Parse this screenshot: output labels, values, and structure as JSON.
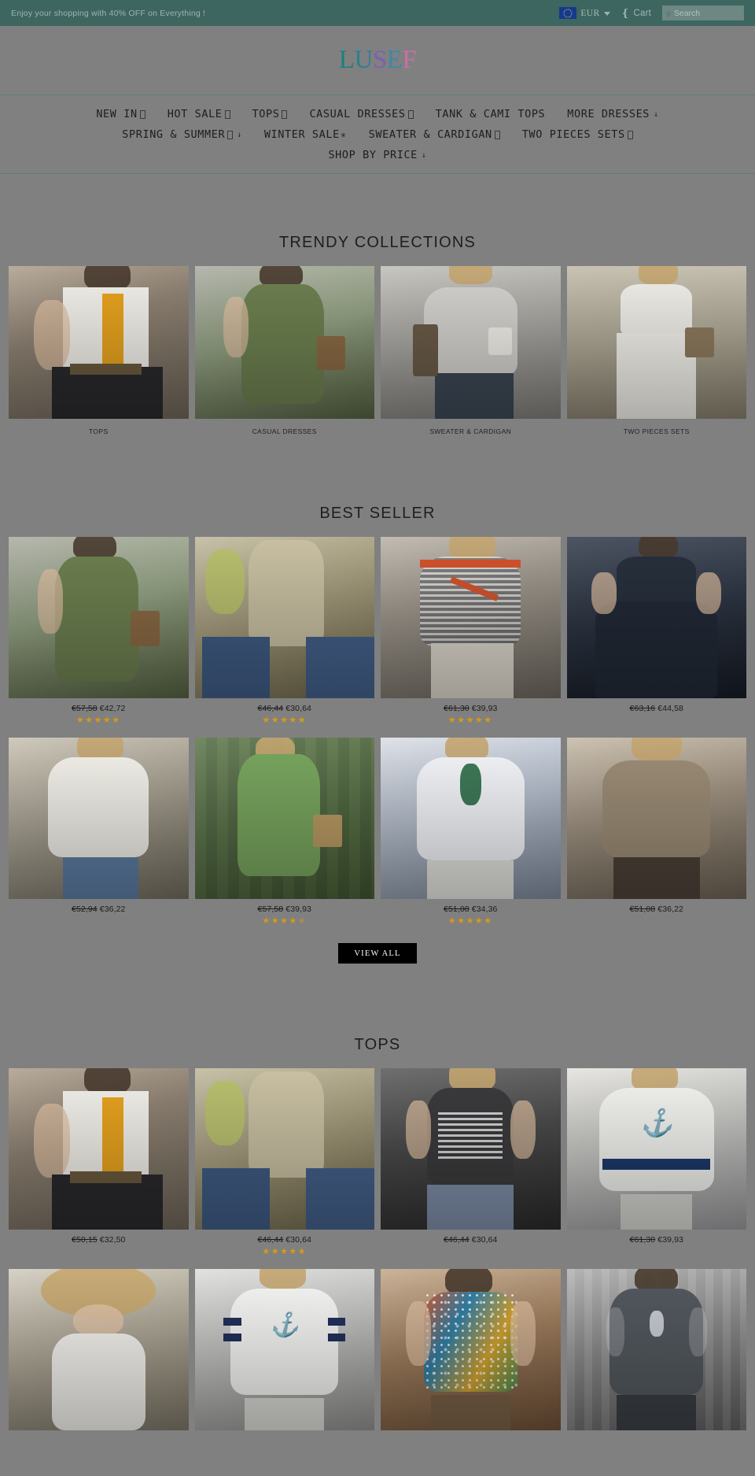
{
  "announcement": {
    "text": "Enjoy your shopping with 40% OFF on Everything !",
    "currency": {
      "code": "EUR",
      "flag_icon": "eu-flag-icon"
    },
    "cart": {
      "label": "Cart",
      "icon": "cart-icon"
    },
    "search": {
      "placeholder": "Search",
      "value": "",
      "icon": "search-icon"
    },
    "bar_color": "#3d6660"
  },
  "brand": {
    "name": "LUSEF",
    "letters": [
      "L",
      "U",
      "S",
      "E",
      "F"
    ]
  },
  "nav": {
    "rows": [
      [
        {
          "label": "NEW IN",
          "badge": true,
          "arrow": false
        },
        {
          "label": "HOT SALE",
          "badge": true,
          "arrow": false
        },
        {
          "label": "TOPS",
          "badge": true,
          "arrow": false
        },
        {
          "label": "CASUAL DRESSES",
          "badge": true,
          "arrow": false
        },
        {
          "label": "TANK & CAMI TOPS",
          "badge": false,
          "arrow": false
        },
        {
          "label": "MORE DRESSES",
          "badge": false,
          "arrow": true
        }
      ],
      [
        {
          "label": "SPRING & SUMMER",
          "badge": true,
          "arrow": true
        },
        {
          "label": "WINTER SALE",
          "badge": false,
          "arrow": false,
          "star": true
        },
        {
          "label": "SWEATER & CARDIGAN",
          "badge": true,
          "arrow": false
        },
        {
          "label": "TWO PIECES SETS",
          "badge": true,
          "arrow": false
        }
      ],
      [
        {
          "label": "SHOP BY PRICE",
          "badge": false,
          "arrow": true
        }
      ]
    ]
  },
  "sections": {
    "trendy": {
      "title": "TRENDY COLLECTIONS",
      "tiles": [
        {
          "caption": "TOPS",
          "art": "p-tops"
        },
        {
          "caption": "CASUAL DRESSES",
          "art": "p-greendr"
        },
        {
          "caption": "SWEATER & CARDIGAN",
          "art": "p-sweater"
        },
        {
          "caption": "TWO PIECES SETS",
          "art": "p-twopiece"
        }
      ]
    },
    "best_seller": {
      "title": "BEST SELLER",
      "view_all_label": "VIEW ALL",
      "products": [
        {
          "old_price": "€57,58",
          "new_price": "€42,72",
          "rating": 5,
          "art": "p-greendr"
        },
        {
          "old_price": "€46,44",
          "new_price": "€30,64",
          "rating": 5,
          "art": "p-lace"
        },
        {
          "old_price": "€61,30",
          "new_price": "€39,93",
          "rating": 5,
          "art": "p-stripe"
        },
        {
          "old_price": "€63,16",
          "new_price": "€44,58",
          "rating": 0,
          "art": "p-navy"
        },
        {
          "old_price": "€52,94",
          "new_price": "€36,22",
          "rating": 0,
          "art": "p-floral"
        },
        {
          "old_price": "€57,58",
          "new_price": "€39,93",
          "rating": 4.5,
          "art": "p-greendoor"
        },
        {
          "old_price": "€51,08",
          "new_price": "€34,36",
          "rating": 5,
          "art": "p-bluedot"
        },
        {
          "old_price": "€51,08",
          "new_price": "€36,22",
          "rating": 0,
          "art": "p-brownpat"
        }
      ]
    },
    "tops": {
      "title": "TOPS",
      "products": [
        {
          "old_price": "€50,15",
          "new_price": "€32,50",
          "rating": 0,
          "art": "p-tops"
        },
        {
          "old_price": "€46,44",
          "new_price": "€30,64",
          "rating": 5,
          "art": "p-lace"
        },
        {
          "old_price": "€46,44",
          "new_price": "€30,64",
          "rating": 0,
          "art": "p-flag"
        },
        {
          "old_price": "€61,30",
          "new_price": "€39,93",
          "rating": 0,
          "art": "p-anchor"
        }
      ],
      "products_row2": [
        {
          "art": "p-hat"
        },
        {
          "art": "p-varsity"
        },
        {
          "art": "p-colorful"
        },
        {
          "art": "p-graytop"
        }
      ]
    }
  }
}
